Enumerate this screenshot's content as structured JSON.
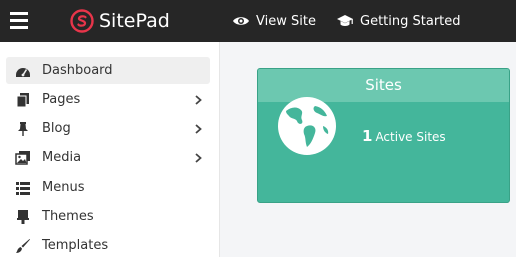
{
  "topbar": {
    "brand": "SitePad",
    "view_site": "View Site",
    "getting_started": "Getting Started"
  },
  "sidebar": {
    "items": [
      {
        "label": "Dashboard",
        "icon": "dashboard-icon"
      },
      {
        "label": "Pages",
        "icon": "pages-icon"
      },
      {
        "label": "Blog",
        "icon": "pin-icon"
      },
      {
        "label": "Media",
        "icon": "media-icon"
      },
      {
        "label": "Menus",
        "icon": "menus-icon"
      },
      {
        "label": "Themes",
        "icon": "themes-icon"
      },
      {
        "label": "Templates",
        "icon": "brush-icon"
      }
    ]
  },
  "card": {
    "title": "Sites",
    "count": "1",
    "count_label": "Active Sites"
  },
  "colors": {
    "topbar": "#262626",
    "brand_logo": "#e8354a",
    "card": "#44b69b",
    "card_header": "#6cc8b0"
  }
}
